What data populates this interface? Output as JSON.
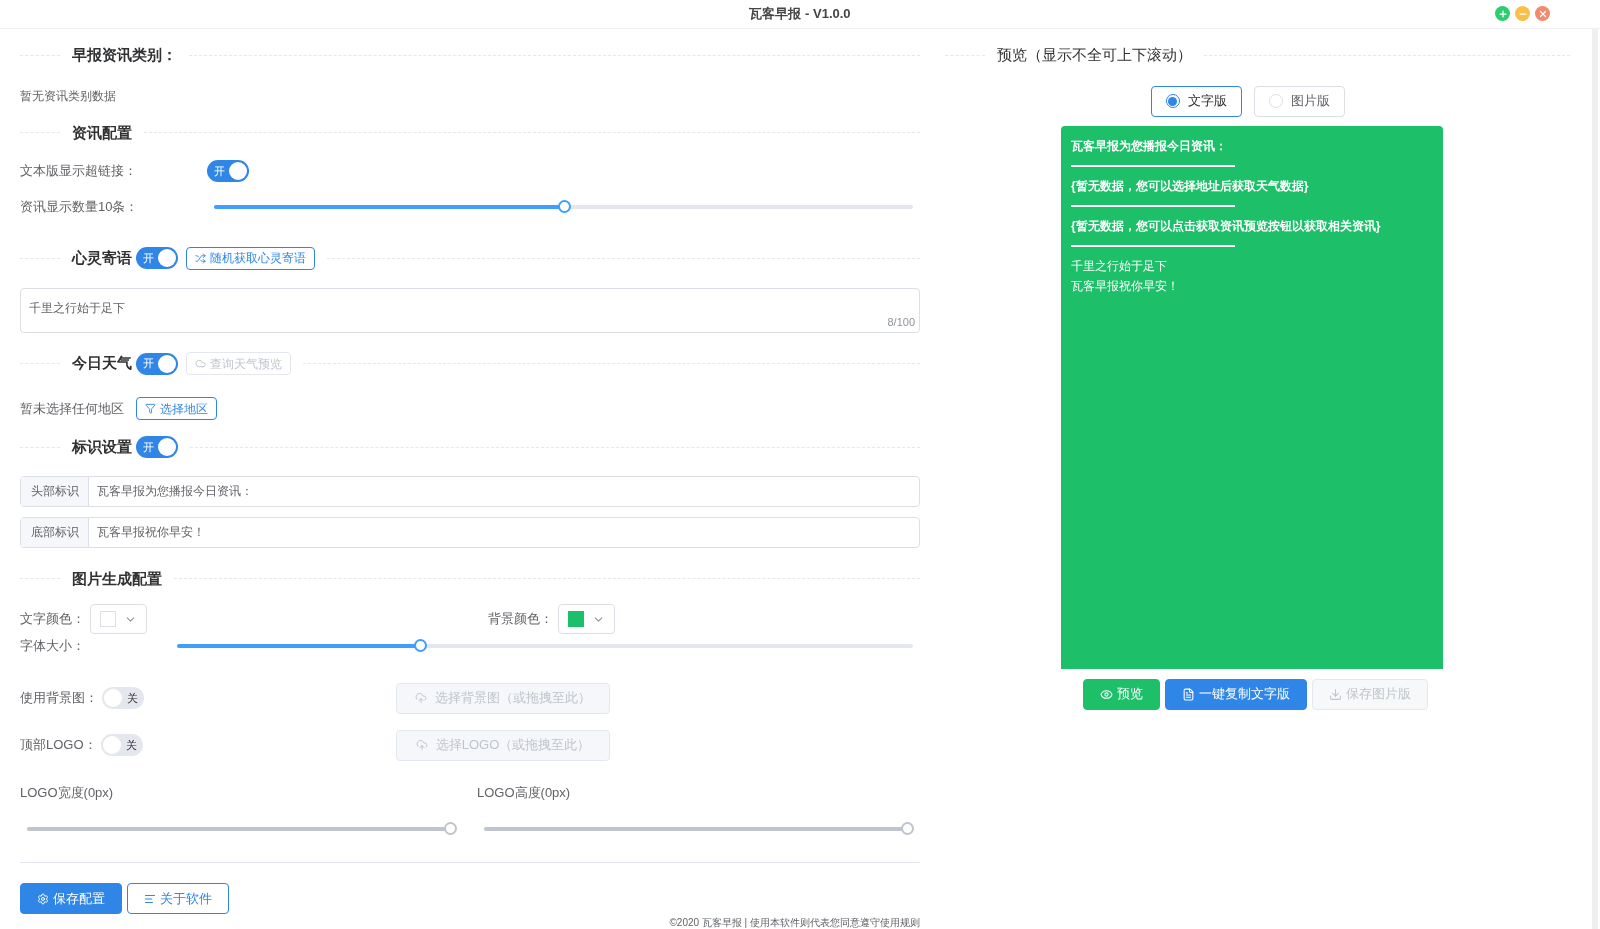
{
  "window": {
    "title": "瓦客早报 - V1.0.0"
  },
  "categories": {
    "title": "早报资讯类别：",
    "empty_text": "暂无资讯类别数据"
  },
  "news_config": {
    "title": "资讯配置",
    "hyperlink": {
      "label": "文本版显示超链接：",
      "toggle": {
        "on": true,
        "text": "开"
      }
    },
    "count": {
      "label": "资讯显示数量10条：",
      "level": 0.5
    }
  },
  "motto": {
    "title": "心灵寄语",
    "toggle": {
      "on": true,
      "text": "开"
    },
    "button": {
      "label": "随机获取心灵寄语",
      "disabled": false
    },
    "value": "千里之行始于足下",
    "counter": "8/100"
  },
  "weather": {
    "title": "今日天气",
    "toggle": {
      "on": true,
      "text": "开"
    },
    "button": {
      "label": "查询天气预览",
      "disabled": true
    },
    "region_text": "暂未选择任何地区",
    "region_button": "选择地区"
  },
  "marks": {
    "title": "标识设置",
    "toggle": {
      "on": true,
      "text": "开"
    },
    "fields": [
      {
        "label": "头部标识",
        "value": "瓦客早报为您播报今日资讯："
      },
      {
        "label": "底部标识",
        "value": "瓦客早报祝你早安！"
      }
    ]
  },
  "image_config": {
    "title": "图片生成配置",
    "text_color": {
      "label": "文字颜色：",
      "color": "#ffffff"
    },
    "bg_color": {
      "label": "背景颜色：",
      "color": "#1dbf69"
    },
    "font_size": {
      "label": "字体大小：",
      "level": 0.33
    },
    "bg_image": {
      "label": "使用背景图：",
      "toggle": {
        "on": false,
        "text": "关"
      },
      "button": "选择背景图（或拖拽至此）"
    },
    "top_logo": {
      "label": "顶部LOGO：",
      "toggle": {
        "on": false,
        "text": "关"
      },
      "button": "选择LOGO（或拖拽至此）"
    },
    "logo_width": {
      "label": "LOGO宽度(0px)",
      "level": 1,
      "disabled": true
    },
    "logo_height": {
      "label": "LOGO高度(0px)",
      "level": 1,
      "disabled": true
    }
  },
  "actions": [
    {
      "label": "保存配置",
      "kind": "primary"
    },
    {
      "label": "关于软件",
      "kind": "outline"
    }
  ],
  "footer": "©2020 瓦客早报 | 使用本软件则代表您同意遵守使用规则",
  "preview": {
    "title": "预览（显示不全可上下滚动）",
    "modes": [
      {
        "label": "文字版",
        "selected": true
      },
      {
        "label": "图片版",
        "selected": false
      }
    ],
    "lines": [
      {
        "kind": "text",
        "text": "瓦客早报为您播报今日资讯："
      },
      {
        "kind": "rule"
      },
      {
        "kind": "text",
        "text": "{暂无数据，您可以选择地址后获取天气数据}"
      },
      {
        "kind": "rule"
      },
      {
        "kind": "text",
        "text": "{暂无数据，您可以点击获取资讯预览按钮以获取相关资讯}"
      },
      {
        "kind": "rule"
      },
      {
        "kind": "plain",
        "text": "千里之行始于足下"
      },
      {
        "kind": "plain",
        "text": "瓦客早报祝你早安！"
      }
    ],
    "buttons": [
      {
        "label": "预览",
        "kind": "green",
        "disabled": false
      },
      {
        "label": "一键复制文字版",
        "kind": "blue",
        "disabled": false
      },
      {
        "label": "保存图片版",
        "kind": "plain",
        "disabled": true
      }
    ]
  }
}
